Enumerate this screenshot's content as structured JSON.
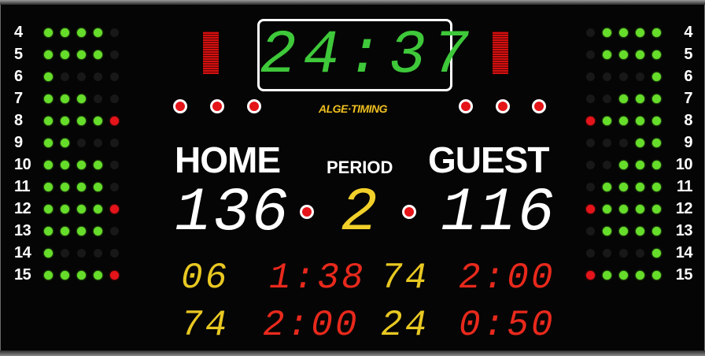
{
  "clock": "24:37",
  "brand": "ALGE·TIMING",
  "home": {
    "label": "HOME",
    "score": "136"
  },
  "guest": {
    "label": "GUEST",
    "score": "116"
  },
  "period_label": "PERIOD",
  "period": "2",
  "penalties": {
    "home": [
      {
        "player": "06",
        "time": "1:38"
      },
      {
        "player": "74",
        "time": "2:00"
      }
    ],
    "guest": [
      {
        "player": "74",
        "time": "2:00"
      },
      {
        "player": "24",
        "time": "0:50"
      }
    ]
  },
  "player_rows": {
    "left": [
      {
        "num": "4",
        "dots": [
          "g",
          "g",
          "g",
          "g",
          "o"
        ]
      },
      {
        "num": "5",
        "dots": [
          "g",
          "g",
          "g",
          "g",
          "o"
        ]
      },
      {
        "num": "6",
        "dots": [
          "g",
          "o",
          "o",
          "o",
          "o"
        ]
      },
      {
        "num": "7",
        "dots": [
          "g",
          "g",
          "g",
          "o",
          "o"
        ]
      },
      {
        "num": "8",
        "dots": [
          "g",
          "g",
          "g",
          "g",
          "r"
        ]
      },
      {
        "num": "9",
        "dots": [
          "g",
          "g",
          "o",
          "o",
          "o"
        ]
      },
      {
        "num": "10",
        "dots": [
          "g",
          "g",
          "g",
          "g",
          "o"
        ]
      },
      {
        "num": "11",
        "dots": [
          "g",
          "g",
          "g",
          "g",
          "o"
        ]
      },
      {
        "num": "12",
        "dots": [
          "g",
          "g",
          "g",
          "g",
          "r"
        ]
      },
      {
        "num": "13",
        "dots": [
          "g",
          "g",
          "g",
          "g",
          "o"
        ]
      },
      {
        "num": "14",
        "dots": [
          "g",
          "o",
          "o",
          "o",
          "o"
        ]
      },
      {
        "num": "15",
        "dots": [
          "g",
          "g",
          "g",
          "g",
          "r"
        ]
      }
    ],
    "right": [
      {
        "num": "4",
        "dots": [
          "g",
          "g",
          "g",
          "g",
          "o"
        ]
      },
      {
        "num": "5",
        "dots": [
          "g",
          "g",
          "g",
          "g",
          "o"
        ]
      },
      {
        "num": "6",
        "dots": [
          "g",
          "o",
          "o",
          "o",
          "o"
        ]
      },
      {
        "num": "7",
        "dots": [
          "g",
          "g",
          "g",
          "o",
          "o"
        ]
      },
      {
        "num": "8",
        "dots": [
          "g",
          "g",
          "g",
          "g",
          "r"
        ]
      },
      {
        "num": "9",
        "dots": [
          "g",
          "g",
          "o",
          "o",
          "o"
        ]
      },
      {
        "num": "10",
        "dots": [
          "g",
          "g",
          "g",
          "o",
          "o"
        ]
      },
      {
        "num": "11",
        "dots": [
          "g",
          "g",
          "g",
          "g",
          "o"
        ]
      },
      {
        "num": "12",
        "dots": [
          "g",
          "g",
          "g",
          "g",
          "r"
        ]
      },
      {
        "num": "13",
        "dots": [
          "g",
          "g",
          "g",
          "g",
          "o"
        ]
      },
      {
        "num": "14",
        "dots": [
          "g",
          "o",
          "o",
          "o",
          "o"
        ]
      },
      {
        "num": "15",
        "dots": [
          "g",
          "g",
          "g",
          "g",
          "r"
        ]
      }
    ]
  },
  "colors": {
    "green": "#66dd2a",
    "red": "#e4141a",
    "yellow": "#e8c822",
    "clock_green": "#3ec83a"
  }
}
